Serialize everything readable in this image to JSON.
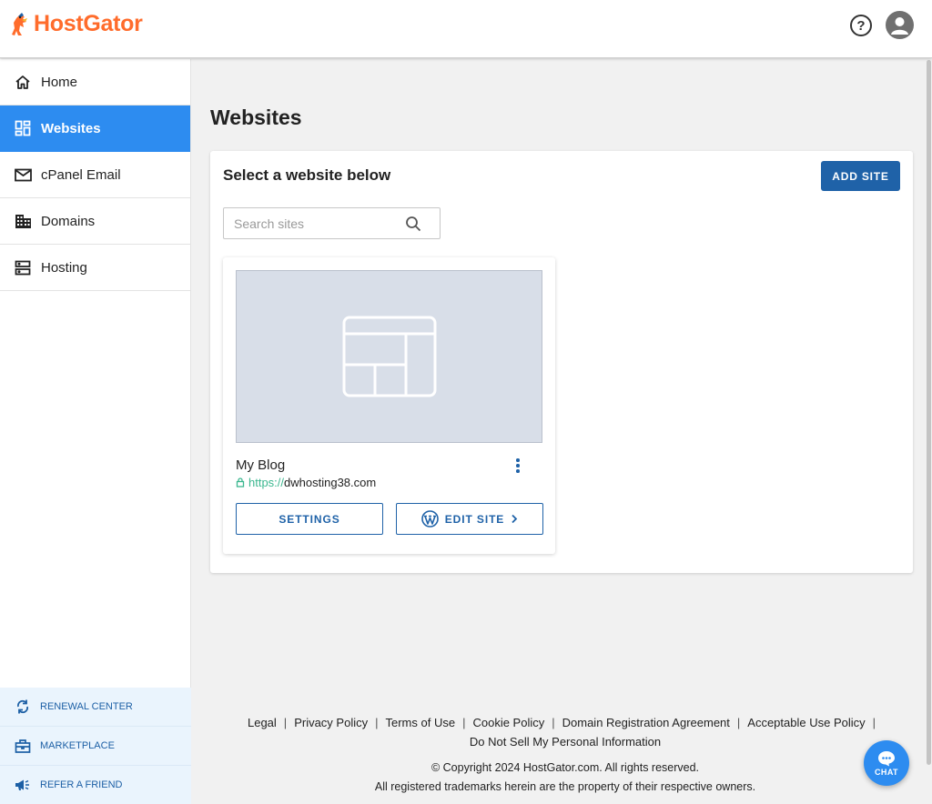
{
  "header": {
    "brand": "HostGator",
    "brand_color": "#ff6c2c",
    "help_icon": "question-circle-icon",
    "account_icon": "user-avatar-icon"
  },
  "sidebar": {
    "items": [
      {
        "label": "Home",
        "icon": "home-icon",
        "active": false
      },
      {
        "label": "Websites",
        "icon": "dashboard-grid-icon",
        "active": true
      },
      {
        "label": "cPanel Email",
        "icon": "mail-icon",
        "active": false
      },
      {
        "label": "Domains",
        "icon": "building-icon",
        "active": false
      },
      {
        "label": "Hosting",
        "icon": "server-icon",
        "active": false
      }
    ],
    "bottom_items": [
      {
        "label": "RENEWAL CENTER",
        "icon": "renew-arrows-icon"
      },
      {
        "label": "MARKETPLACE",
        "icon": "store-icon"
      },
      {
        "label": "REFER A FRIEND",
        "icon": "megaphone-icon"
      }
    ],
    "active_color": "#2d8cf0"
  },
  "main": {
    "title": "Websites",
    "panel_title": "Select a website below",
    "add_site_label": "ADD SITE",
    "search_placeholder": "Search sites",
    "sites": [
      {
        "name": "My Blog",
        "url_protocol": "https://",
        "url_domain": "dwhosting38.com",
        "settings_label": "SETTINGS",
        "edit_label": "EDIT SITE"
      }
    ]
  },
  "footer": {
    "links": [
      "Legal",
      "Privacy Policy",
      "Terms of Use",
      "Cookie Policy",
      "Domain Registration Agreement",
      "Acceptable Use Policy",
      "Do Not Sell My Personal Information"
    ],
    "copyright": "© Copyright 2024 HostGator.com. All rights reserved.",
    "trademark": "All registered trademarks herein are the property of their respective owners."
  },
  "chat": {
    "label": "CHAT"
  },
  "colors": {
    "primary_button": "#1f62a8",
    "secure_url": "#3bb78f"
  }
}
